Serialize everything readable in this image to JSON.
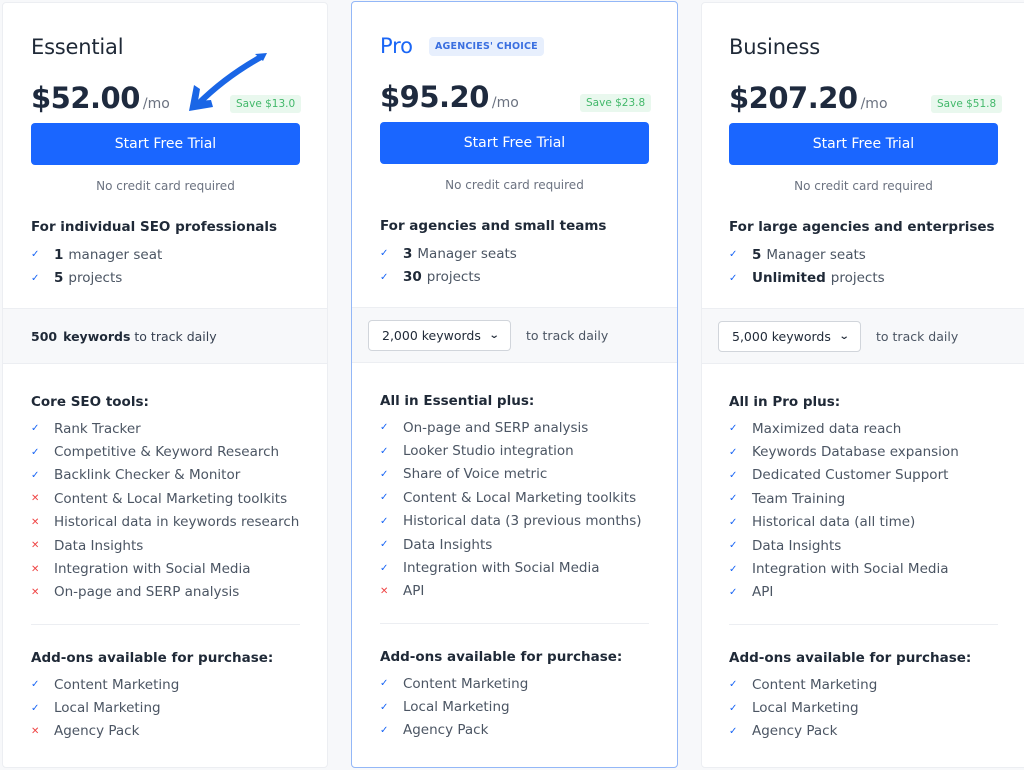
{
  "plans": [
    {
      "name": "Essential",
      "badge": null,
      "price": "$52.00",
      "period": "/mo",
      "save": "Save $13.0",
      "cta": "Start Free Trial",
      "note": "No credit card required",
      "audience": "For individual SEO professionals",
      "seats": [
        {
          "bold": "1",
          "text": "manager seat",
          "status": "check"
        },
        {
          "bold": "5",
          "text": "projects",
          "status": "check"
        }
      ],
      "keywords": {
        "type": "static",
        "value": "500",
        "unit": "keywords",
        "suffix": "to track daily"
      },
      "features_title": "Core SEO tools:",
      "features": [
        {
          "text": "Rank Tracker",
          "status": "check"
        },
        {
          "text": "Competitive & Keyword Research",
          "status": "check"
        },
        {
          "text": "Backlink Checker & Monitor",
          "status": "check"
        },
        {
          "text": "Content & Local Marketing toolkits",
          "status": "cross"
        },
        {
          "text": "Historical data in keywords research",
          "status": "cross"
        },
        {
          "text": "Data Insights",
          "status": "cross"
        },
        {
          "text": "Integration with Social Media",
          "status": "cross"
        },
        {
          "text": "On-page and SERP analysis",
          "status": "cross"
        }
      ],
      "addons_title": "Add-ons available for purchase:",
      "addons": [
        {
          "text": "Content Marketing",
          "status": "check"
        },
        {
          "text": "Local Marketing",
          "status": "check"
        },
        {
          "text": "Agency Pack",
          "status": "cross"
        }
      ]
    },
    {
      "name": "Pro",
      "badge": "AGENCIES' CHOICE",
      "price": "$95.20",
      "period": "/mo",
      "save": "Save $23.8",
      "cta": "Start Free Trial",
      "note": "No credit card required",
      "audience": "For agencies and small teams",
      "seats": [
        {
          "bold": "3",
          "text": "Manager seats",
          "status": "check"
        },
        {
          "bold": "30",
          "text": "projects",
          "status": "check"
        }
      ],
      "keywords": {
        "type": "select",
        "value": "2,000 keywords",
        "suffix": "to track daily"
      },
      "features_title": "All in Essential plus:",
      "features": [
        {
          "text": "On-page and SERP analysis",
          "status": "check"
        },
        {
          "text": "Looker Studio integration",
          "status": "check"
        },
        {
          "text": "Share of Voice metric",
          "status": "check"
        },
        {
          "text": "Content & Local Marketing toolkits",
          "status": "check"
        },
        {
          "text": "Historical data (3 previous months)",
          "status": "check"
        },
        {
          "text": "Data Insights",
          "status": "check"
        },
        {
          "text": "Integration with Social Media",
          "status": "check"
        },
        {
          "text": "API",
          "status": "cross"
        }
      ],
      "addons_title": "Add-ons available for purchase:",
      "addons": [
        {
          "text": "Content Marketing",
          "status": "check"
        },
        {
          "text": "Local Marketing",
          "status": "check"
        },
        {
          "text": "Agency Pack",
          "status": "check"
        }
      ]
    },
    {
      "name": "Business",
      "badge": null,
      "price": "$207.20",
      "period": "/mo",
      "save": "Save $51.8",
      "cta": "Start Free Trial",
      "note": "No credit card required",
      "audience": "For large agencies and enterprises",
      "seats": [
        {
          "bold": "5",
          "text": "Manager seats",
          "status": "check"
        },
        {
          "bold": "Unlimited",
          "text": "projects",
          "status": "check"
        }
      ],
      "keywords": {
        "type": "select",
        "value": "5,000 keywords",
        "suffix": "to track daily"
      },
      "features_title": "All in Pro plus:",
      "features": [
        {
          "text": "Maximized data reach",
          "status": "check"
        },
        {
          "text": "Keywords Database expansion",
          "status": "check"
        },
        {
          "text": "Dedicated Customer Support",
          "status": "check"
        },
        {
          "text": "Team Training",
          "status": "check"
        },
        {
          "text": "Historical data (all time)",
          "status": "check"
        },
        {
          "text": "Data Insights",
          "status": "check"
        },
        {
          "text": "Integration with Social Media",
          "status": "check"
        },
        {
          "text": "API",
          "status": "check"
        }
      ],
      "addons_title": "Add-ons available for purchase:",
      "addons": [
        {
          "text": "Content Marketing",
          "status": "check"
        },
        {
          "text": "Local Marketing",
          "status": "check"
        },
        {
          "text": "Agency Pack",
          "status": "check"
        }
      ]
    }
  ],
  "icons": {
    "check": "✓",
    "cross": "✕",
    "chevron": "⌄"
  },
  "colors": {
    "accent": "#1a66ff",
    "check": "#1a66f5",
    "cross": "#ef4444",
    "save_bg": "#e9f8ee",
    "save_text": "#42b86a",
    "arrow": "#1a66e6"
  }
}
